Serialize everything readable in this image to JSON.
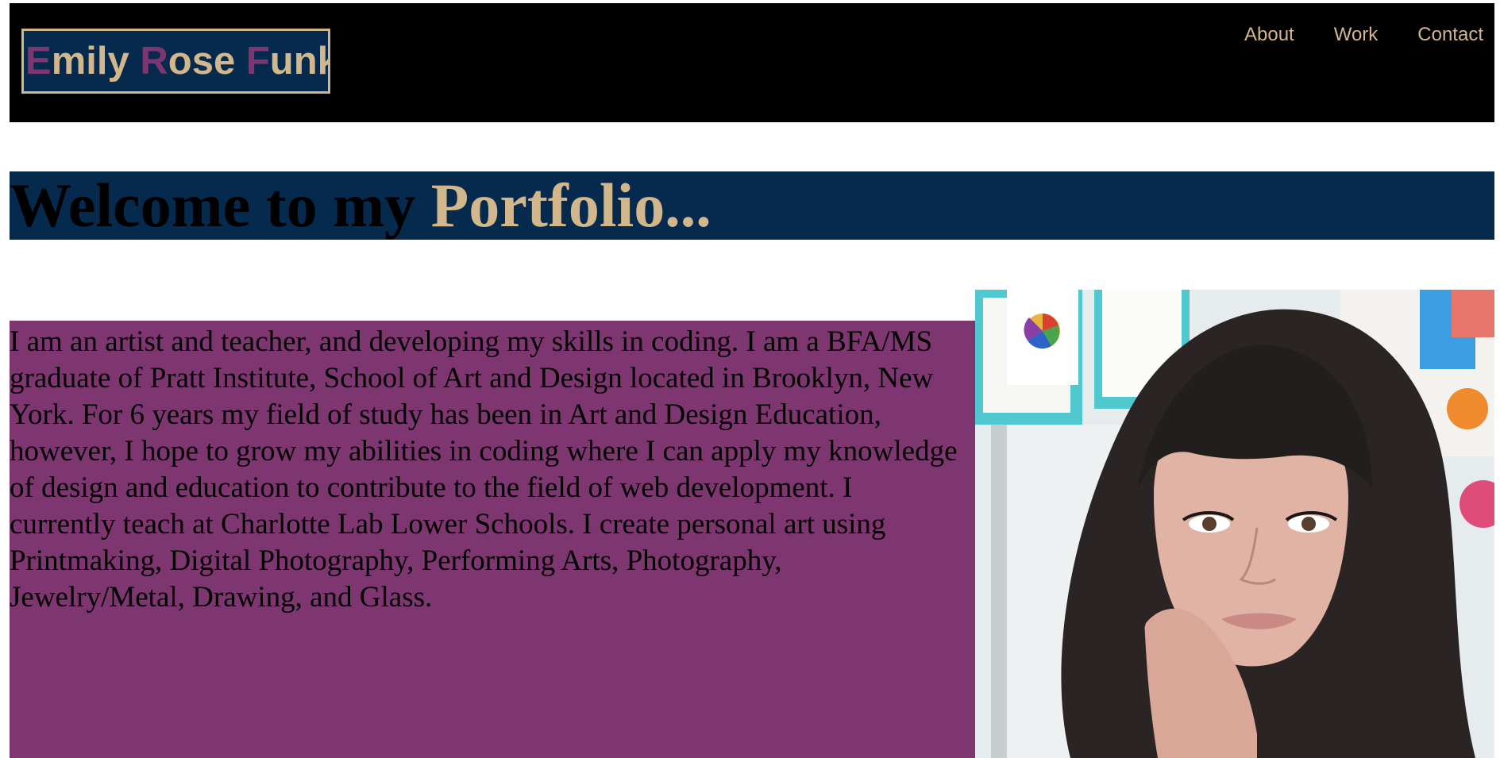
{
  "header": {
    "logo": {
      "first_initial": "E",
      "first_rest": "mily",
      "middle_initial": "R",
      "middle_rest": "ose",
      "last_initial": "F",
      "last_rest": "unk"
    },
    "nav": [
      {
        "label": "About"
      },
      {
        "label": "Work"
      },
      {
        "label": "Contact"
      }
    ]
  },
  "welcome": {
    "lead": "Welcome to my ",
    "accent": "Portfolio...",
    "accent_color": "#d1b78b"
  },
  "bio": {
    "text": "I am an artist and teacher, and developing my skills in coding. I am a BFA/MS graduate of Pratt Institute, School of Art and Design located in Brooklyn, New York. For 6 years my field of study has been in Art and Design Education, however, I hope to grow my abilities in coding where I can apply my knowledge of design and education to contribute to the field of web development. I currently teach at Charlotte Lab Lower Schools. I create personal art using Printmaking, Digital Photography, Performing Arts, Photography, Jewelry/Metal, Drawing, and Glass."
  },
  "colors": {
    "header_bg": "#000000",
    "navy": "#052a4d",
    "gold": "#d1b78b",
    "plum": "#7e3670"
  },
  "photo": {
    "icon": "portrait-photo"
  }
}
